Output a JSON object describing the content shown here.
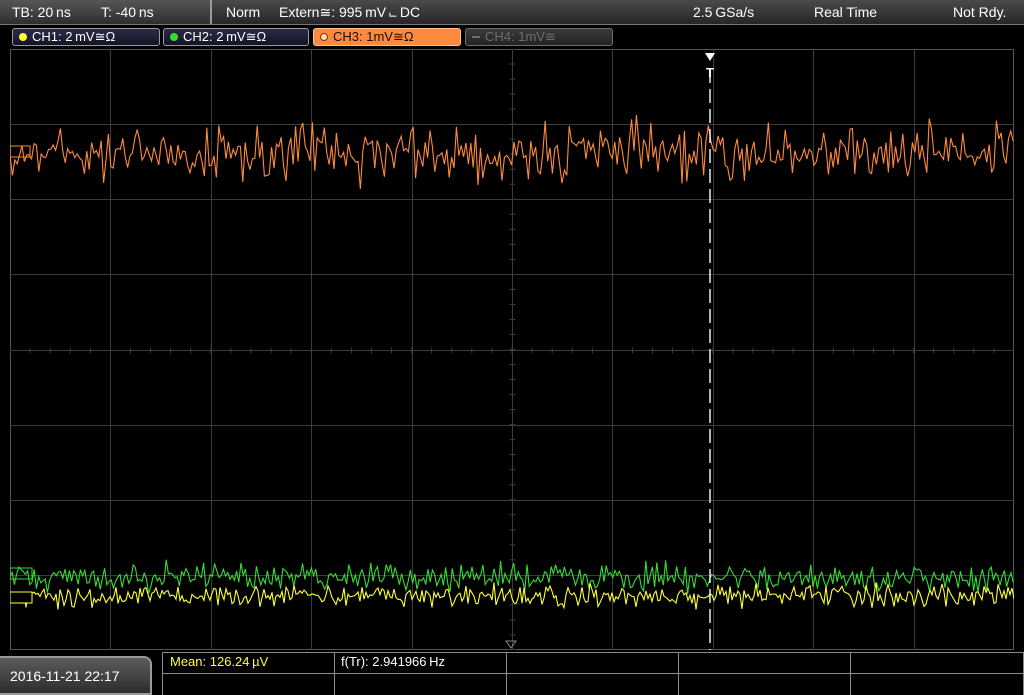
{
  "status_bar": {
    "timebase": "TB: 20 ns",
    "trigger_time": "T: -40 ns",
    "trigger_mode": "Norm",
    "trigger_source": "Extern≅: 995 mV ⨽ DC",
    "sample_rate": "2.5 GSa/s",
    "acquisition_mode": "Real Time",
    "run_status": "Not Rdy."
  },
  "channels": [
    {
      "label": "CH1: 2 mV≅Ω",
      "color": "#ffff33",
      "state": "on"
    },
    {
      "label": "CH2: 2 mV≅Ω",
      "color": "#33dd33",
      "state": "on"
    },
    {
      "label": "CH3: 1mV≅Ω",
      "color": "#ff8a3d",
      "state": "selected"
    },
    {
      "label": "CH4: 1mV≅",
      "color": "#6e6e6e",
      "state": "off"
    }
  ],
  "trigger_marker": "T",
  "measurements": {
    "mean": "Mean: 126.24 µV",
    "frequency": "f(Tr): 2.941966 Hz"
  },
  "datetime": "2016-11-21 22:17",
  "colors": {
    "ch1": "#ffff33",
    "ch2": "#33dd33",
    "ch3": "#ff8a3d",
    "grid": "#3c3c3c",
    "measurement_text": "#ffff33"
  },
  "icons": [
    "trigger-position-icon",
    "ground-reference-icon",
    "channel-dot-icon"
  ]
}
